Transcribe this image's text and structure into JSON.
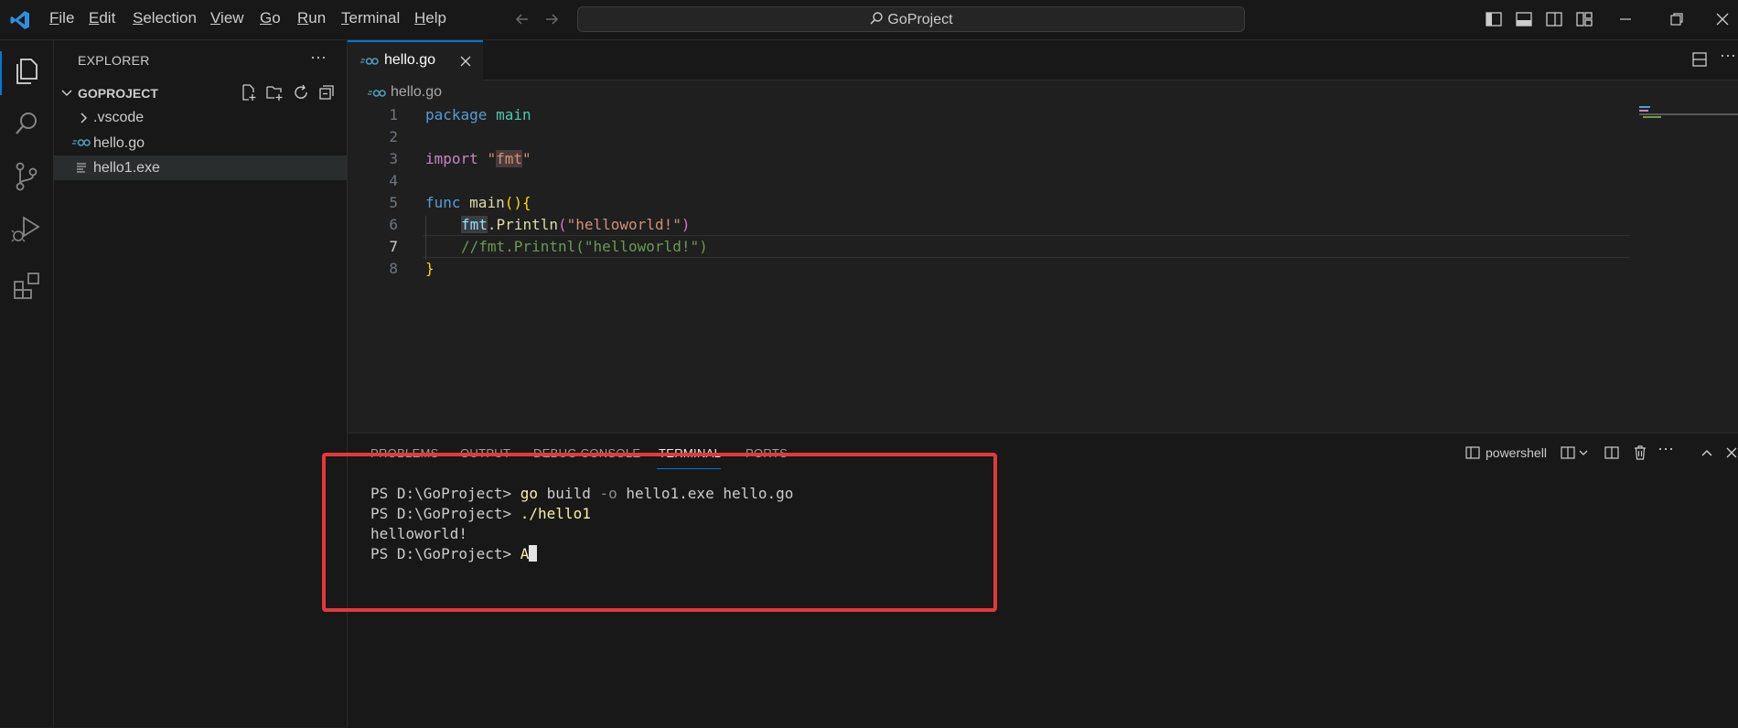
{
  "titlebar": {
    "menu": [
      {
        "pre": "",
        "u": "F",
        "post": "ile"
      },
      {
        "pre": "",
        "u": "E",
        "post": "dit"
      },
      {
        "pre": "",
        "u": "S",
        "post": "election"
      },
      {
        "pre": "",
        "u": "V",
        "post": "iew"
      },
      {
        "pre": "",
        "u": "G",
        "post": "o"
      },
      {
        "pre": "",
        "u": "R",
        "post": "un"
      },
      {
        "pre": "",
        "u": "T",
        "post": "erminal"
      },
      {
        "pre": "",
        "u": "H",
        "post": "elp"
      }
    ],
    "search_text": "GoProject"
  },
  "sidebar": {
    "title": "EXPLORER",
    "more": "···",
    "folder": "GOPROJECT",
    "items": [
      {
        "label": ".vscode",
        "icon": "chevron-right-icon"
      },
      {
        "label": "hello.go",
        "icon": "go-file-icon"
      },
      {
        "label": "hello1.exe",
        "icon": "generic-file-icon"
      }
    ]
  },
  "editor": {
    "tab_label": "hello.go",
    "breadcrumb": "hello.go",
    "line_numbers": [
      "1",
      "2",
      "3",
      "4",
      "5",
      "6",
      "7",
      "8"
    ],
    "line1": {
      "kw": "package",
      "name": "main"
    },
    "line3": {
      "kw": "import",
      "q1": "\"",
      "pkg": "fmt",
      "q2": "\""
    },
    "line5": {
      "kw": "func",
      "name": "main",
      "parens": "()",
      "brace": "{"
    },
    "line6": {
      "pkg": "fmt",
      "dot": ".",
      "fn": "Println",
      "lp": "(",
      "str": "\"helloworld!\"",
      "rp": ")"
    },
    "line7": {
      "text": "//fmt.Printnl(\"helloworld!\")"
    },
    "line8": {
      "brace": "}"
    }
  },
  "panel": {
    "tabs": [
      "PROBLEMS",
      "OUTPUT",
      "DEBUG CONSOLE",
      "TERMINAL",
      "PORTS"
    ],
    "shell_label": "powershell",
    "terminal": {
      "l1_prompt": "PS D:\\GoProject> ",
      "l1_cmd": "go",
      "l1_rest1": " build ",
      "l1_flag": "-o",
      "l1_rest2": " hello1.exe hello.go",
      "l2_prompt": "PS D:\\GoProject> ",
      "l2_cmd": "./hello1",
      "l3": "helloworld!",
      "l4_prompt": "PS D:\\GoProject> ",
      "l4_input": "A"
    }
  },
  "colors": {
    "accent": "#0078d4",
    "highlight_box": "#e5383b"
  }
}
